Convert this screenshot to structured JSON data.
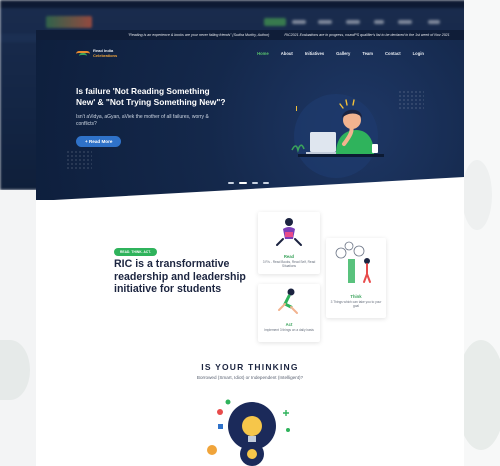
{
  "ticker": {
    "items": [
      "\"Reading is an experience & books are your never failing friends\" (Sudha Murthy, Author)",
      "RIC2021 Evaluations are in progress, roundPS qualifier's list to be declared in the 1st week of Nov 2021"
    ]
  },
  "header": {
    "logo_line1": "Read India",
    "logo_line2": "Celebrations",
    "nav": [
      "Home",
      "About",
      "Initiatives",
      "Gallery",
      "Team",
      "Contact",
      "Login"
    ],
    "active_nav": "Home"
  },
  "hero": {
    "title": "Is failure 'Not Reading Something New' & \"Not Trying Something New\"?",
    "subtitle": "Isn't aVidya, aGyan, aViek the mother of all failures, worry & conflicts?",
    "button": "+ Read More",
    "slide_count": 4,
    "active_slide": 2
  },
  "ric": {
    "tag": "READ. THINK. ACT.",
    "title": "RIC is a transformative readership and leadership initiative for students"
  },
  "cards": {
    "read": {
      "title": "Read",
      "text": "3 R's - Read Books, Read Self, Read Situations"
    },
    "think": {
      "title": "Think",
      "text": "3 Things which can take you to your goal"
    },
    "act": {
      "title": "Act",
      "text": "Implement 3 things on a daily basis"
    }
  },
  "thinking": {
    "title": "IS YOUR THINKING",
    "subtitle": "Borrowed (Smart, Idiot) or Independent (Intelligent)?"
  },
  "colors": {
    "navy": "#14284b",
    "green": "#2fb35c",
    "blue": "#2f72c9"
  }
}
